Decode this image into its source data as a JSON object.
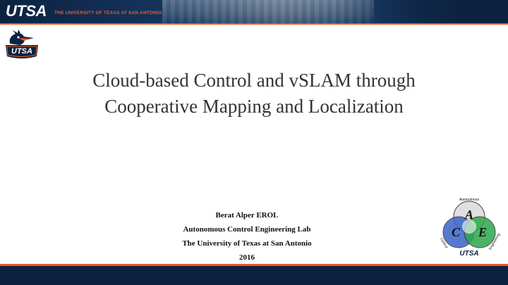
{
  "header": {
    "brand": "UTSA",
    "subtitle": "THE UNIVERSITY OF TEXAS AT SAN ANTONIO"
  },
  "logos": {
    "left_logo_text": "UTSA",
    "ace_letters": [
      "A",
      "C",
      "E"
    ],
    "ace_ring_top": "Autonomous",
    "ace_ring_left": "Control",
    "ace_ring_right": "Engineering",
    "ace_bottom": "UTSA"
  },
  "slide": {
    "title_line1": "Cloud-based Control and vSLAM through",
    "title_line2": "Cooperative Mapping and Localization",
    "author": "Berat Alper EROL",
    "lab": "Autonomous Control Engineering Lab",
    "university": "The University  of Texas at San Antonio",
    "year": "2016"
  },
  "colors": {
    "navy": "#0c2340",
    "orange": "#f15a22",
    "title_text": "#333333"
  }
}
